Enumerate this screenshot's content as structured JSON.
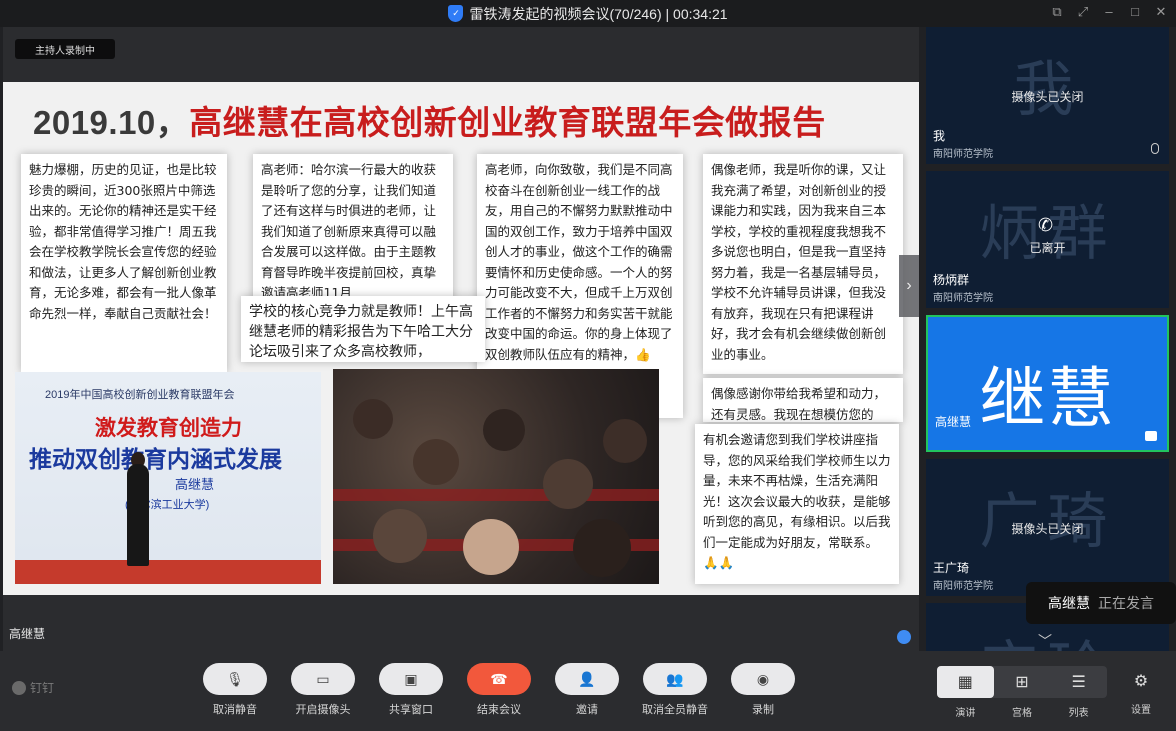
{
  "window": {
    "title": "雷铁涛发起的视频会议(70/246) | 00:34:21"
  },
  "stage": {
    "record_badge": "主持人录制中",
    "presenter_name": "高继慧",
    "slide": {
      "title_year": "2019.10，",
      "title_rest": "高继慧在高校创新创业教育联盟年会做报告",
      "notes": [
        "魅力爆棚，历史的见证，也是比较珍贵的瞬间，近300张照片中筛选出来的。无论你的精神还是实干经验，都非常值得学习推广！周五我会在学校教学院长会宣传您的经验和做法，让更多人了解创新创业教育，无论多难，都会有一批人像革命先烈一样，奉献自己贡献社会！",
        "高老师：哈尔滨一行最大的收获是聆听了您的分享，让我们知道了还有这样与时俱进的老师，让我们知道了创新原来真得可以融合发展可以这样做。由于主题教育督导昨晚半夜提前回校，真挚邀请高老师11月",
        "学校的核心竞争力就是教师！上午高继慧老师的精彩报告为下午哈工大分论坛吸引来了众多高校教师，",
        "高老师，向你致敬，我们是不同高校奋斗在创新创业一线工作的战友，用自己的不懈努力默默推动中国的双创工作，致力于培养中国双创人才的事业，做这个工作的确需要情怀和历史使命感。一个人的努力可能改变不大，但成千上万双创工作者的不懈努力和务实苦干就能改变中国的命运。你的身上体现了双创教师队伍应有的精神，👍",
        "偶像老师，我是听你的课，又让我充满了希望，对创新创业的授课能力和实践，因为我来自三本学校，学校的重视程度我想我不多说您也明白，但是我一直坚持努力着，我是一名基层辅导员，学校不允许辅导员讲课，但我没有放弃，我现在只有把课程讲好，我才会有机会继续做创新创业的事业。",
        "偶像感谢你带给我希望和动力，还有灵感。我现在想模仿您的",
        "有机会邀请您到我们学校讲座指导，您的风采给我们学校师生以力量，未来不再枯燥，生活充满阳光！这次会议最大的收获，是能够听到您的高见，有缘相识。以后我们一定能成为好朋友，常联系。🙏🙏"
      ],
      "photo_banner": {
        "top": "2019年中国高校创新创业教育联盟年会",
        "line1": "激发教育创造力",
        "line2": "推动双创教育内涵式发展",
        "speaker": "高继慧",
        "org": "(哈尔滨工业大学)"
      }
    }
  },
  "participants": [
    {
      "avatar_text": "我",
      "status": "摄像头已关闭",
      "name": "我",
      "org": "南阳师范学院"
    },
    {
      "avatar_text": "炳群",
      "status": "已离开",
      "name": "杨炳群",
      "org": "南阳师范学院"
    },
    {
      "avatar_text": "继慧",
      "status": "",
      "name": "高继慧",
      "org": ""
    },
    {
      "avatar_text": "广琦",
      "status": "摄像头已关闭",
      "name": "王广琦",
      "org": "南阳师范学院"
    },
    {
      "avatar_text": "宝玲",
      "status": "",
      "name": "",
      "org": ""
    }
  ],
  "speaking_toast": {
    "name": "高继慧",
    "status": "正在发言"
  },
  "toolbar": {
    "brand": "钉钉",
    "buttons": [
      "取消静音",
      "开启摄像头",
      "共享窗口",
      "结束会议",
      "邀请",
      "取消全员静音",
      "录制"
    ],
    "views": [
      "演讲",
      "宫格",
      "列表"
    ],
    "settings": "设置"
  },
  "colors": {
    "accent": "#1676e6",
    "end_call": "#f2583c",
    "speaking_border": "#22c45e",
    "title_red": "#c81d1d"
  }
}
